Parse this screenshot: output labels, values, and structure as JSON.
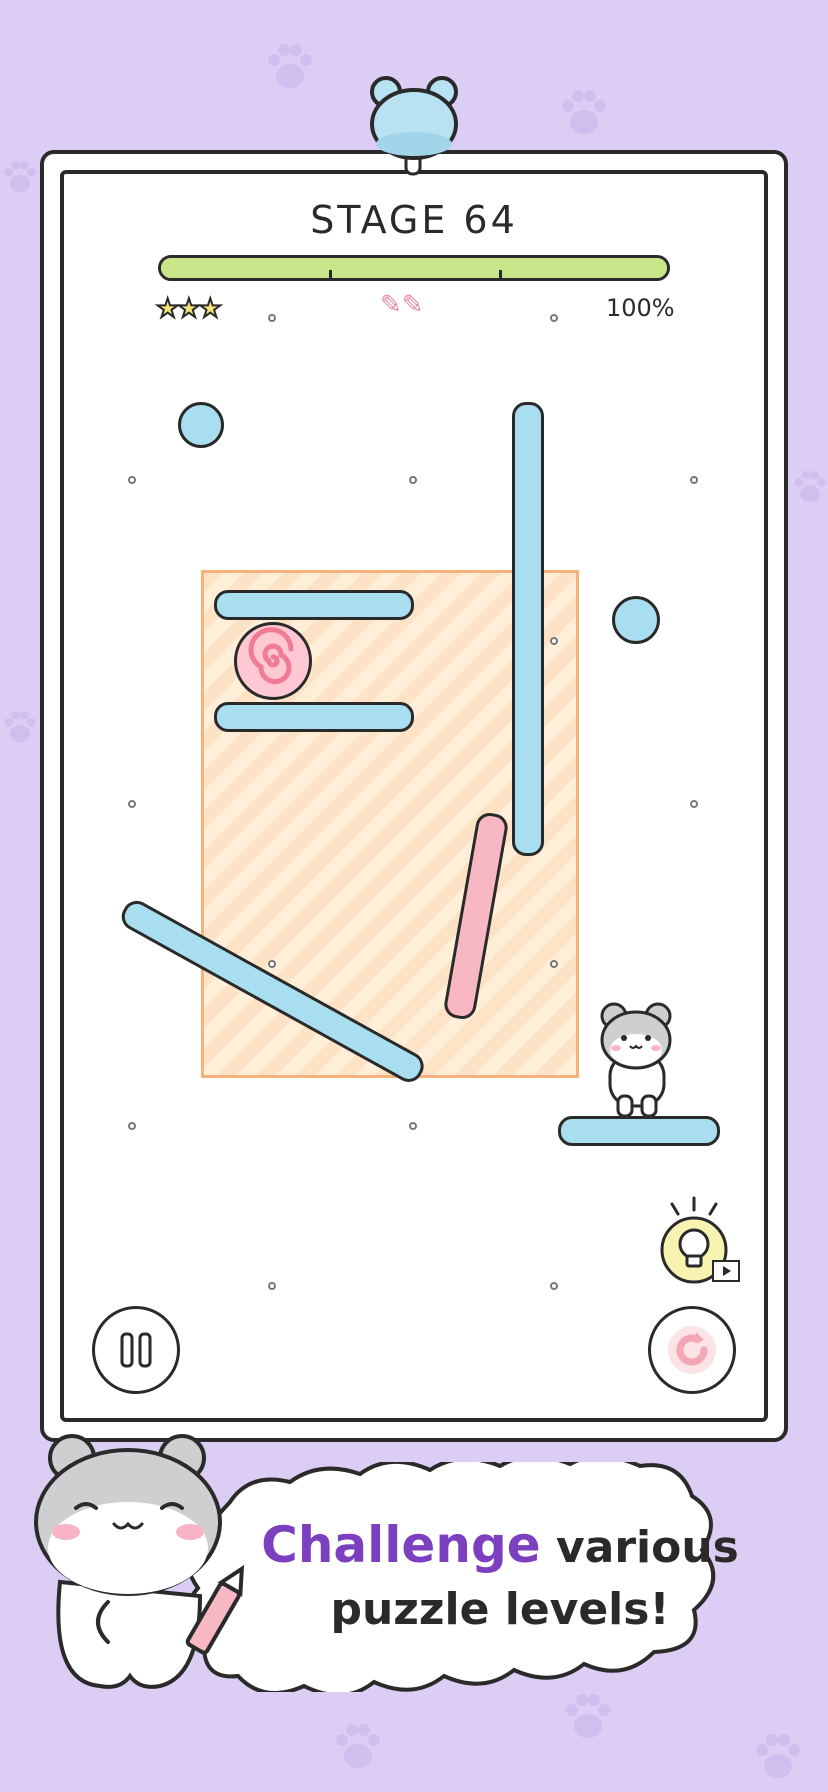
{
  "stage": {
    "title": "STAGE 64",
    "progress_percent_label": "100%",
    "progress": 1.0,
    "stars": "★★★",
    "pencils": "✎✎"
  },
  "promo": {
    "highlight": "Challenge",
    "rest_line1": " various",
    "line2": "puzzle levels!"
  },
  "icons": {
    "paws": "paw-icon",
    "top_mascot": "hamster-head-icon",
    "pause": "pause-icon",
    "restart": "restart-icon",
    "hint": "lightbulb-icon",
    "video": "video-icon"
  },
  "colors": {
    "background": "#dccdf4",
    "bar_blue": "#a9def0",
    "drawn_pink": "#f7b8c4",
    "zone_orange": "#f5b27a",
    "progress_green": "#c8e58a",
    "accent_purple": "#7b3fbf"
  }
}
